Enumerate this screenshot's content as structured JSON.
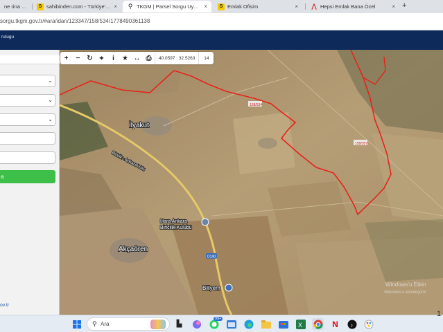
{
  "browser": {
    "tabs": [
      {
        "label": "ne rina Oltr",
        "favicon": "",
        "close": ""
      },
      {
        "label": "sahibinden.com - Türkiye'nin O",
        "favicon": "S",
        "close": "×"
      },
      {
        "label": "TKGM | Parsel Sorgu Uygulama",
        "favicon": "⚲",
        "close": "×"
      },
      {
        "label": "Emlak Ofisim",
        "favicon": "S",
        "close": "×"
      },
      {
        "label": "Hepsi Emlak Bana Özel",
        "favicon": "⋀",
        "close": "×"
      }
    ],
    "new_tab": "+",
    "url": "sorgu.tkgm.gov.tr/#ara/idari/123347/158/534/1778490361138"
  },
  "site": {
    "header_title": "rulugu"
  },
  "panel": {
    "query_button": "a",
    "footer_link": "ov.tr"
  },
  "map": {
    "tools": [
      "+",
      "−",
      "↻",
      "⌖",
      "i",
      "★",
      "↔",
      "⎙"
    ],
    "coords": "40.0597 : 32.5263",
    "zoom": "14",
    "labels": {
      "village_1": "İlyakut",
      "road_1": "Biricik - Ankara Yolu",
      "parcel_1": "158/534",
      "parcel_2": "158/357",
      "farm_line1": "Hara Ankara",
      "farm_line2": "Biricilik Kulübü",
      "road_code": "D140",
      "village_2": "Akçaören",
      "village_3": "Biliyem"
    },
    "watermark": "Windows'u Etkin",
    "watermark_sub": "Windows'u etkinleştirm"
  },
  "taskbar": {
    "search_placeholder": "Ara",
    "badge": "99+",
    "clock_fragment": "1"
  },
  "colors": {
    "parcel_border": "#e8231a",
    "header": "#0d2a5a",
    "query_button": "#3dbf49"
  }
}
